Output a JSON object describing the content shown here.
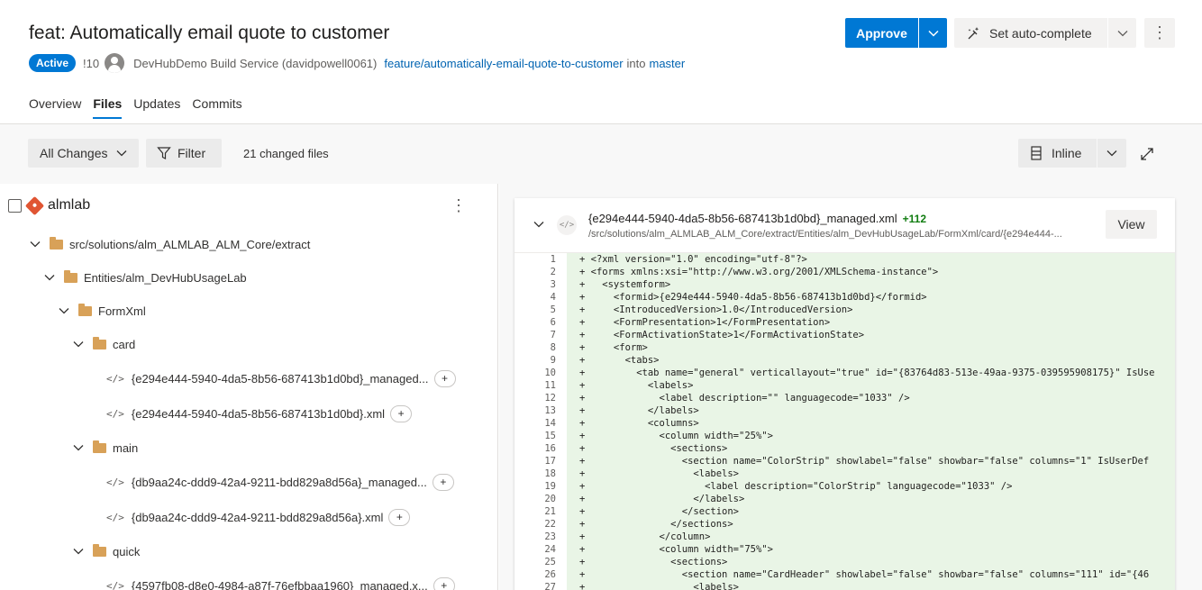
{
  "pr": {
    "title": "feat: Automatically email quote to customer",
    "status": "Active",
    "id": "!10",
    "author": "DevHubDemo Build Service (davidpowell0061)",
    "source_branch": "feature/automatically-email-quote-to-customer",
    "into": "into",
    "target_branch": "master"
  },
  "actions": {
    "approve": "Approve",
    "auto_complete": "Set auto-complete",
    "more": "⋮"
  },
  "tabs": [
    {
      "label": "Overview"
    },
    {
      "label": "Files"
    },
    {
      "label": "Updates"
    },
    {
      "label": "Commits"
    }
  ],
  "toolbar": {
    "all_changes": "All Changes",
    "filter": "Filter",
    "changed_files": "21 changed files",
    "view_mode": "Inline"
  },
  "tree": {
    "repo": "almlab",
    "more": "⋮",
    "items": [
      {
        "label": "src/solutions/alm_ALMLAB_ALM_Core/extract"
      },
      {
        "label": "Entities/alm_DevHubUsageLab"
      },
      {
        "label": "FormXml"
      },
      {
        "label": "card"
      },
      {
        "label": "{e294e444-5940-4da5-8b56-687413b1d0bd}_managed..."
      },
      {
        "label": "{e294e444-5940-4da5-8b56-687413b1d0bd}.xml"
      },
      {
        "label": "main"
      },
      {
        "label": "{db9aa24c-ddd9-42a4-9211-bdd829a8d56a}_managed..."
      },
      {
        "label": "{db9aa24c-ddd9-42a4-9211-bdd829a8d56a}.xml"
      },
      {
        "label": "quick"
      },
      {
        "label": "{4597fb08-d8e0-4984-a87f-76efbbaa1960}_managed.x..."
      }
    ]
  },
  "diff": {
    "filename": "{e294e444-5940-4da5-8b56-687413b1d0bd}_managed.xml",
    "additions": "+112",
    "path": "/src/solutions/alm_ALMLAB_ALM_Core/extract/Entities/alm_DevHubUsageLab/FormXml/card/{e294e444-...",
    "view": "View",
    "file_icon": "</>",
    "lines": [
      {
        "n": "1",
        "t": "+ <?xml version=\"1.0\" encoding=\"utf-8\"?>"
      },
      {
        "n": "2",
        "t": "+ <forms xmlns:xsi=\"http://www.w3.org/2001/XMLSchema-instance\">"
      },
      {
        "n": "3",
        "t": "+   <systemform>"
      },
      {
        "n": "4",
        "t": "+     <formid>{e294e444-5940-4da5-8b56-687413b1d0bd}</formid>"
      },
      {
        "n": "5",
        "t": "+     <IntroducedVersion>1.0</IntroducedVersion>"
      },
      {
        "n": "6",
        "t": "+     <FormPresentation>1</FormPresentation>"
      },
      {
        "n": "7",
        "t": "+     <FormActivationState>1</FormActivationState>"
      },
      {
        "n": "8",
        "t": "+     <form>"
      },
      {
        "n": "9",
        "t": "+       <tabs>"
      },
      {
        "n": "10",
        "t": "+         <tab name=\"general\" verticallayout=\"true\" id=\"{83764d83-513e-49aa-9375-039595908175}\" IsUse"
      },
      {
        "n": "11",
        "t": "+           <labels>"
      },
      {
        "n": "12",
        "t": "+             <label description=\"\" languagecode=\"1033\" />"
      },
      {
        "n": "13",
        "t": "+           </labels>"
      },
      {
        "n": "14",
        "t": "+           <columns>"
      },
      {
        "n": "15",
        "t": "+             <column width=\"25%\">"
      },
      {
        "n": "16",
        "t": "+               <sections>"
      },
      {
        "n": "17",
        "t": "+                 <section name=\"ColorStrip\" showlabel=\"false\" showbar=\"false\" columns=\"1\" IsUserDef"
      },
      {
        "n": "18",
        "t": "+                   <labels>"
      },
      {
        "n": "19",
        "t": "+                     <label description=\"ColorStrip\" languagecode=\"1033\" />"
      },
      {
        "n": "20",
        "t": "+                   </labels>"
      },
      {
        "n": "21",
        "t": "+                 </section>"
      },
      {
        "n": "22",
        "t": "+               </sections>"
      },
      {
        "n": "23",
        "t": "+             </column>"
      },
      {
        "n": "24",
        "t": "+             <column width=\"75%\">"
      },
      {
        "n": "25",
        "t": "+               <sections>"
      },
      {
        "n": "26",
        "t": "+                 <section name=\"CardHeader\" showlabel=\"false\" showbar=\"false\" columns=\"111\" id=\"{46"
      },
      {
        "n": "27",
        "t": "+                   <labels>"
      }
    ]
  },
  "colors": {
    "accent": "#0078d4",
    "added_bg": "#e9f5e6",
    "added_count": "#107c10",
    "folder": "#d8a158",
    "git": "#e05533"
  }
}
